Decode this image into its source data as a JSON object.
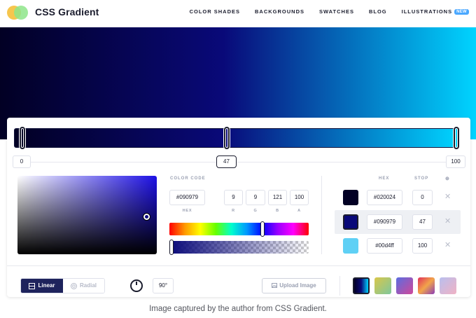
{
  "app": {
    "brand": "CSS Gradient",
    "nav": [
      {
        "label": "COLOR SHADES"
      },
      {
        "label": "BACKGROUNDS"
      },
      {
        "label": "SWATCHES"
      },
      {
        "label": "BLOG"
      },
      {
        "label": "ILLUSTRATIONS",
        "badge": "NEW"
      }
    ]
  },
  "hero": {
    "colors": [
      "#020024",
      "#090979",
      "#00d4ff"
    ]
  },
  "gradient_bar": {
    "stop_labels": [
      "0",
      "47",
      "100"
    ],
    "stop_positions": [
      0,
      47,
      100
    ],
    "active_stop": 1
  },
  "picker": {
    "section_label": "COLOR CODE",
    "hex": "#090979",
    "r": "9",
    "g": "9",
    "b": "121",
    "a": "100",
    "labels": {
      "hex": "HEX",
      "r": "R",
      "g": "G",
      "b": "B",
      "a": "A"
    },
    "hue_level": 0.67,
    "alpha_level": 1.0
  },
  "stops_table": {
    "headers": {
      "hex": "HEX",
      "stop": "STOP",
      "add": "⊕"
    },
    "rows": [
      {
        "color": "#020024",
        "hex": "#020024",
        "stop": "0",
        "selected": false
      },
      {
        "color": "#090979",
        "hex": "#090979",
        "stop": "47",
        "selected": true
      },
      {
        "color": "#5fd0f5",
        "hex": "#00d4ff",
        "stop": "100",
        "selected": false
      }
    ],
    "remove_glyph": "✕"
  },
  "controls": {
    "linear_label": "Linear",
    "radial_label": "Radial",
    "angle": "90°",
    "upload_label": "Upload Image"
  },
  "presets": [
    {
      "colors": [
        "#020024",
        "#090979",
        "#00d4ff"
      ],
      "active": true
    },
    {
      "colors": [
        "#d9c74a",
        "#7ec79d"
      ],
      "active": false
    },
    {
      "colors": [
        "#5b6de0",
        "#d0489a"
      ],
      "active": false
    },
    {
      "colors": [
        "#e0305a",
        "#f2a44a",
        "#8a3db8"
      ],
      "active": false
    },
    {
      "colors": [
        "#b9bfee",
        "#f0b2c4"
      ],
      "active": false
    }
  ],
  "caption": "Image captured by the author from CSS Gradient."
}
